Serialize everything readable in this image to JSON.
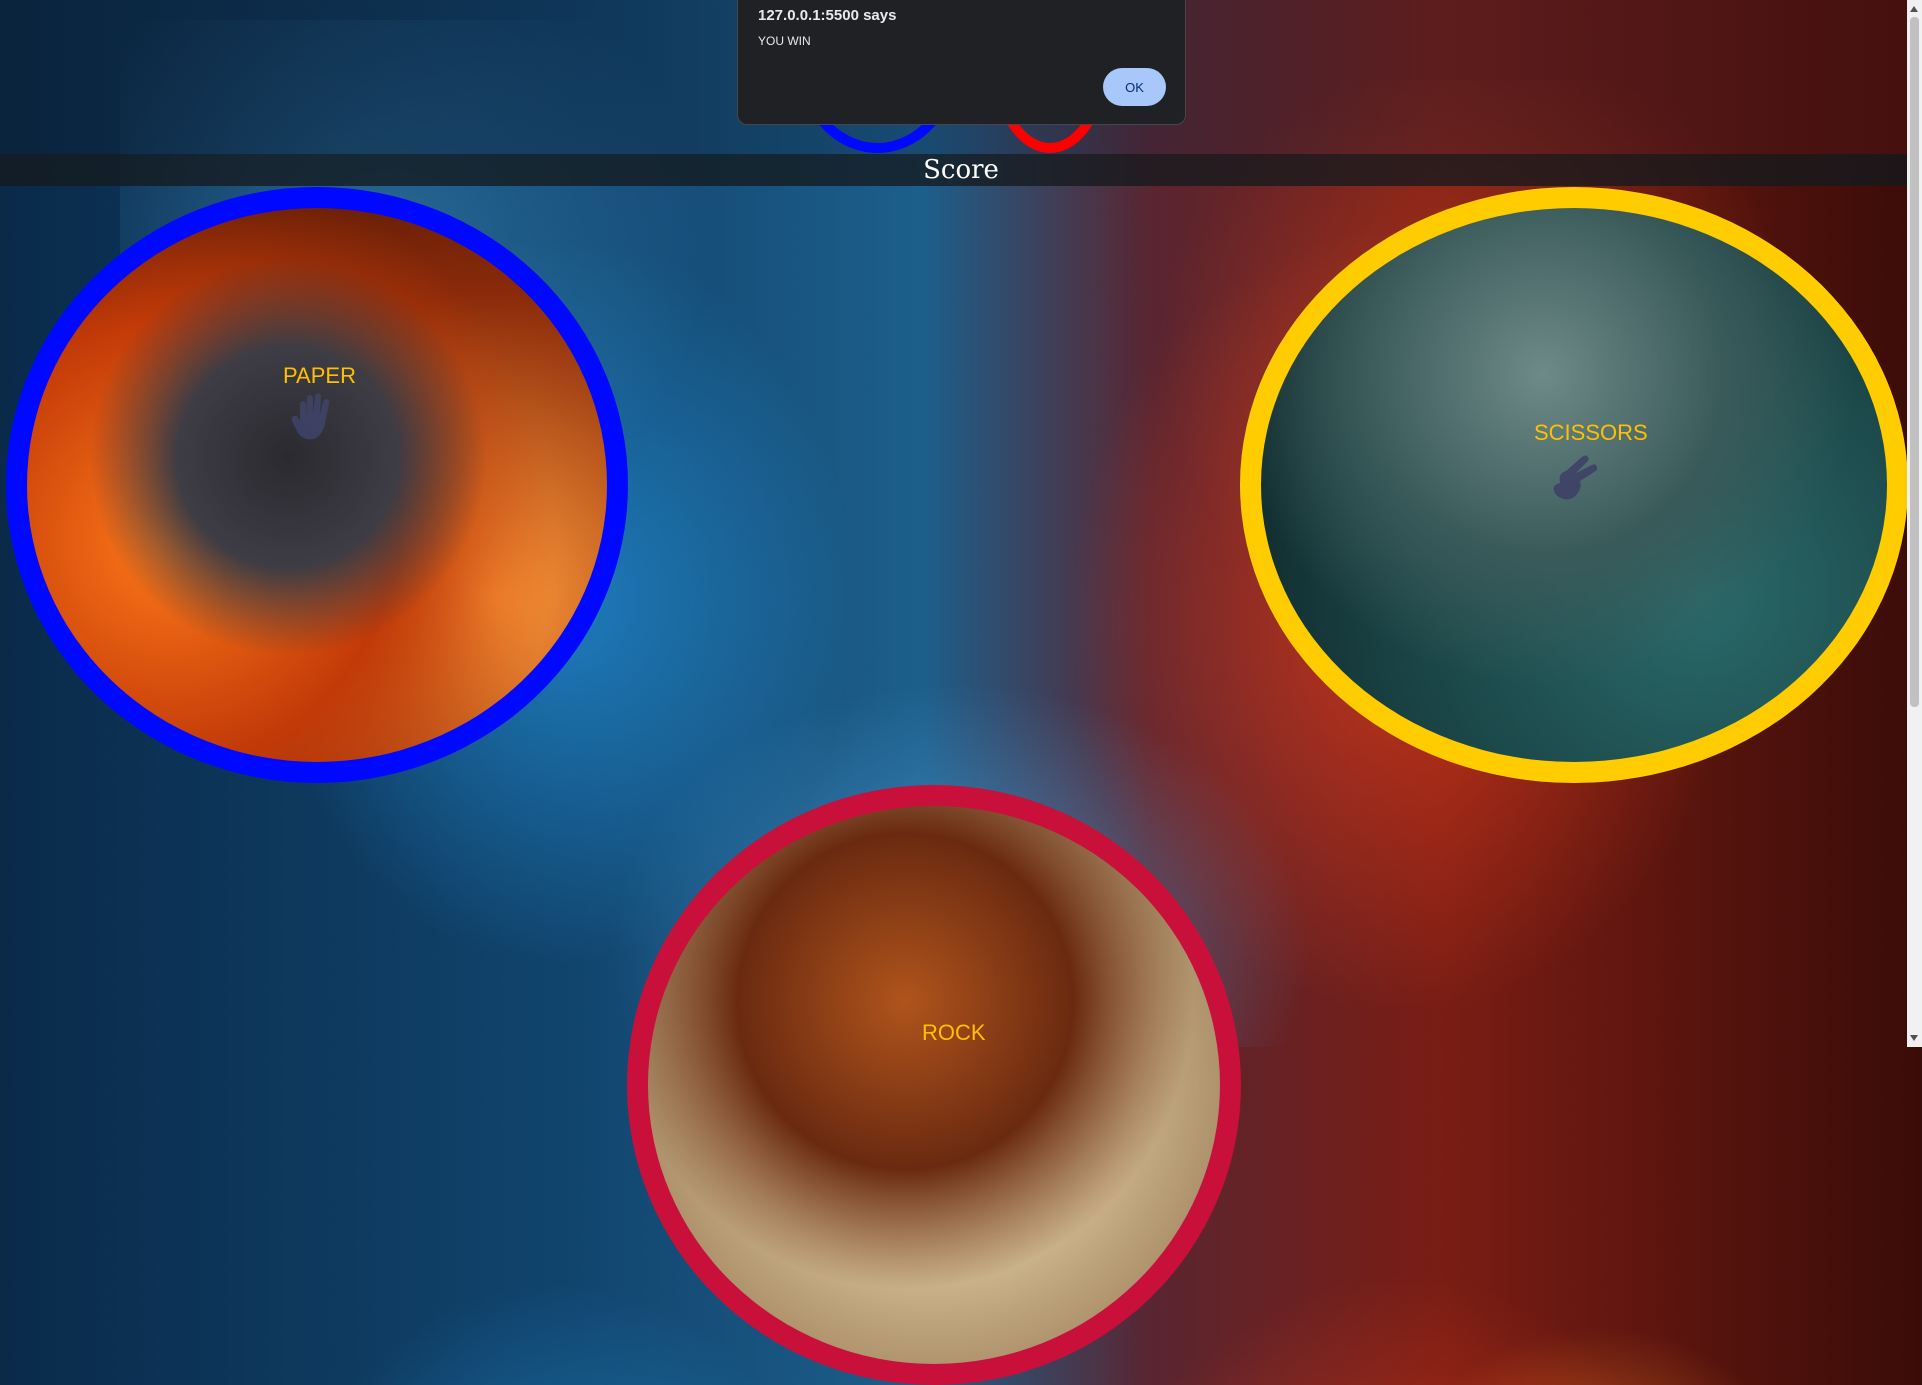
{
  "alert": {
    "origin": "127.0.0.1:5500 says",
    "message": "YOU WIN",
    "ok_label": "OK"
  },
  "score": {
    "title": "Score"
  },
  "choices": {
    "paper": {
      "label": "PAPER",
      "icon": "hand-paper-icon",
      "ring_color": "#0008ff"
    },
    "scissors": {
      "label": "SCISSORS",
      "icon": "hand-scissors-icon",
      "ring_color": "#ffcc00"
    },
    "rock": {
      "label": "ROCK",
      "icon": "dragon-image",
      "ring_color": "#c8103a"
    }
  },
  "score_rings": {
    "player_color": "#0008ff",
    "computer_color": "#ff0000"
  },
  "icons": {
    "paper": "hand-paper-icon",
    "scissors": "hand-scissors-icon"
  }
}
